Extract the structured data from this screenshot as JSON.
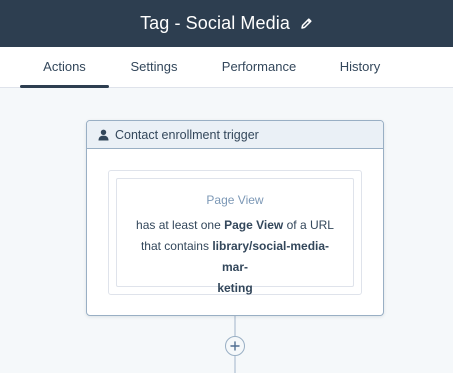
{
  "header": {
    "title": "Tag - Social Media",
    "edit_icon": "pencil-icon"
  },
  "tabs": [
    {
      "label": "Actions",
      "active": true
    },
    {
      "label": "Settings",
      "active": false
    },
    {
      "label": "Performance",
      "active": false
    },
    {
      "label": "History",
      "active": false
    }
  ],
  "trigger": {
    "icon": "contact-icon",
    "header_label": "Contact enrollment trigger",
    "filter": {
      "title": "Page View",
      "prefix": "has at least one",
      "event": "Page View",
      "middle": "of a URL",
      "line2": "that contains",
      "value_line1": "library/social-media-mar-",
      "value_line2": "keting"
    }
  },
  "add_action": {
    "icon": "plus-icon"
  },
  "colors": {
    "header_bg": "#2d3e50",
    "page_bg": "#f5f8fa",
    "card_border": "#99afc4",
    "card_header_bg": "#eaf0f6",
    "muted_text": "#7c98b6"
  }
}
